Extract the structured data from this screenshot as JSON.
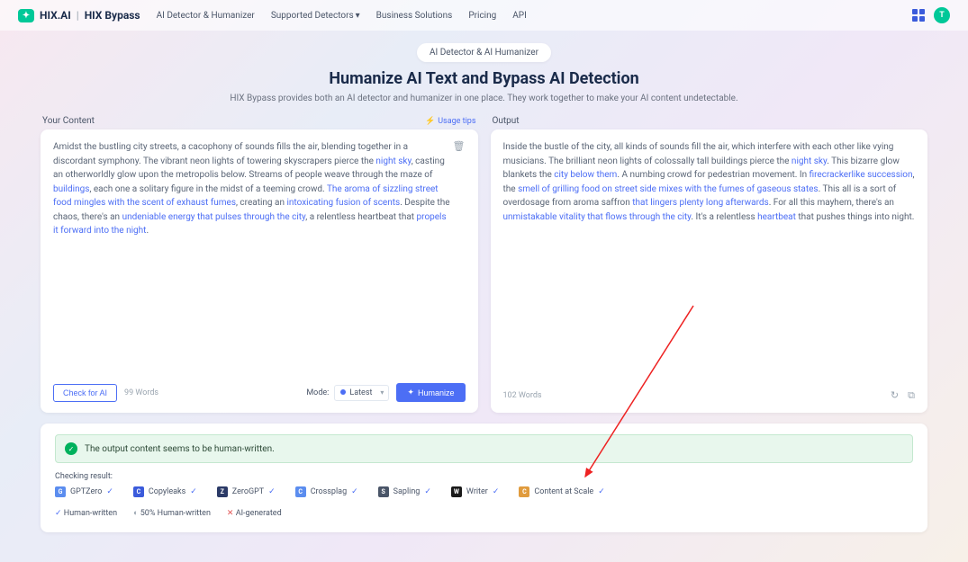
{
  "header": {
    "brand_main": "HIX.AI",
    "brand_sub": "HIX Bypass",
    "nav": [
      "AI Detector & Humanizer",
      "Supported Detectors",
      "Business Solutions",
      "Pricing",
      "API"
    ],
    "avatar_letter": "T"
  },
  "hero": {
    "badge": "AI Detector & AI Humanizer",
    "title": "Humanize AI Text and Bypass AI Detection",
    "subtitle": "HIX Bypass provides both an AI detector and humanizer in one place. They work together to make your AI content undetectable."
  },
  "input": {
    "label": "Your Content",
    "usage_tips": "Usage tips",
    "text_pre": "Amidst the bustling city streets, a cacophony of sounds fills the air, blending together in a discordant symphony. The vibrant neon lights of towering skyscrapers pierce the ",
    "hl1": "night sky",
    "text_mid1": ", casting an otherworldly glow upon the metropolis below. Streams of people weave through the maze of ",
    "hl2": "buildings",
    "text_mid2": ", each one a solitary figure in the midst of a teeming crowd. ",
    "hl3": "The aroma of sizzling street food mingles with the scent of exhaust fumes",
    "text_mid3": ", creating an ",
    "hl4": "intoxicating fusion of scents",
    "text_mid4": ". Despite the chaos, there's an ",
    "hl5": "undeniable energy that pulses through the city",
    "text_mid5": ", a relentless heartbeat that ",
    "hl6": "propels it forward into the night",
    "text_end": ".",
    "check_btn": "Check for AI",
    "word_count": "99 Words",
    "mode_label": "Mode:",
    "mode_value": "Latest",
    "humanize_btn": "Humanize"
  },
  "output": {
    "label": "Output",
    "text_pre": "Inside the bustle of the city, all kinds of sounds fill the air, which interfere with each other like vying musicians. The brilliant neon lights of colossally tall buildings pierce the ",
    "hl1": "night sky",
    "text_mid1": ". This bizarre glow blankets the ",
    "hl2": "city below them",
    "text_mid2": ". A numbing crowd for pedestrian movement. In ",
    "hl3": "firecrackerlike succession",
    "text_mid3": ", the ",
    "hl4": "smell of grilling food on street side mixes with the fumes of gaseous states",
    "text_mid4": ". This all is a sort of overdosage from aroma saffron ",
    "hl5": "that lingers plenty long afterwards",
    "text_mid5": ". For all this mayhem, there's an ",
    "hl6": "unmistakable vitality that flows through the city",
    "text_mid6": ". It's a relentless ",
    "hl7": "heartbeat",
    "text_mid7": " that pushes things into night.",
    "word_count": "102 Words"
  },
  "result": {
    "banner": "The output content seems to be human-written.",
    "checking_label": "Checking result:",
    "detectors": [
      {
        "name": "GPTZero",
        "color": "#5b8def"
      },
      {
        "name": "Copyleaks",
        "color": "#3b5bdb"
      },
      {
        "name": "ZeroGPT",
        "color": "#2b3a67"
      },
      {
        "name": "Crossplag",
        "color": "#5b8def"
      },
      {
        "name": "Sapling",
        "color": "#4a5568"
      },
      {
        "name": "Writer",
        "color": "#1a1a1a"
      },
      {
        "name": "Content at Scale",
        "color": "#e09b3d"
      }
    ],
    "legend_human": "Human-written",
    "legend_half": "50% Human-written",
    "legend_ai": "AI-generated"
  }
}
